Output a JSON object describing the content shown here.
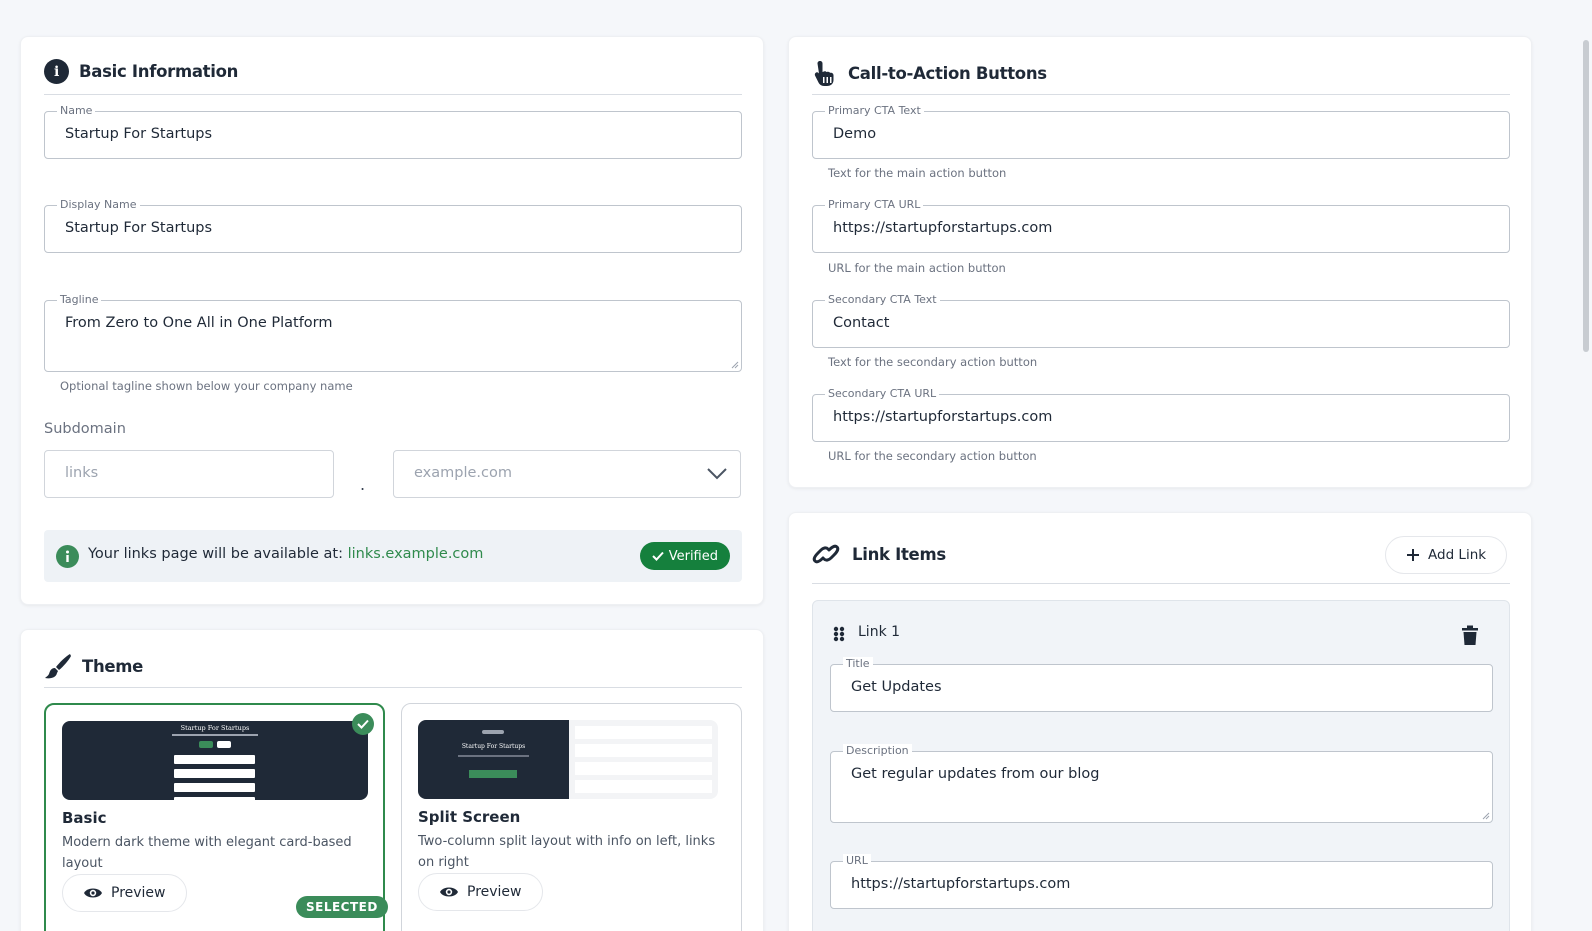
{
  "basic_info": {
    "title": "Basic Information",
    "name_label": "Name",
    "name_value": "Startup For Startups",
    "display_name_label": "Display Name",
    "display_name_value": "Startup For Startups",
    "tagline_label": "Tagline",
    "tagline_value": "From Zero to One All in One Platform",
    "tagline_helper": "Optional tagline shown below your company name",
    "subdomain_label": "Subdomain",
    "subdomain_placeholder": "links",
    "separator": ".",
    "domain_placeholder": "example.com",
    "availability_text": "Your links page will be available at:",
    "availability_url": "links.example.com",
    "verified_label": "Verified"
  },
  "theme": {
    "title": "Theme",
    "cards": [
      {
        "name": "Basic",
        "description": "Modern dark theme with elegant card-based layout",
        "preview_label": "Preview",
        "badge": "SELECTED",
        "thumb_title": "Startup For Startups"
      },
      {
        "name": "Split Screen",
        "description": "Two-column split layout with info on left, links on right",
        "preview_label": "Preview",
        "thumb_title": "Startup For Startups"
      }
    ]
  },
  "cta": {
    "title": "Call-to-Action Buttons",
    "primary_text_label": "Primary CTA Text",
    "primary_text_value": "Demo",
    "primary_text_helper": "Text for the main action button",
    "primary_url_label": "Primary CTA URL",
    "primary_url_value": "https://startupforstartups.com",
    "primary_url_helper": "URL for the main action button",
    "secondary_text_label": "Secondary CTA Text",
    "secondary_text_value": "Contact",
    "secondary_text_helper": "Text for the secondary action button",
    "secondary_url_label": "Secondary CTA URL",
    "secondary_url_value": "https://startupforstartups.com",
    "secondary_url_helper": "URL for the secondary action button"
  },
  "links": {
    "title": "Link Items",
    "add_label": "Add Link",
    "items": [
      {
        "heading": "Link 1",
        "title_label": "Title",
        "title_value": "Get Updates",
        "description_label": "Description",
        "description_value": "Get regular updates from our blog",
        "url_label": "URL",
        "url_value": "https://startupforstartups.com"
      }
    ]
  },
  "colors": {
    "accent_green": "#2f8a4c",
    "verified_green": "#15803d",
    "dark": "#1f2937"
  }
}
